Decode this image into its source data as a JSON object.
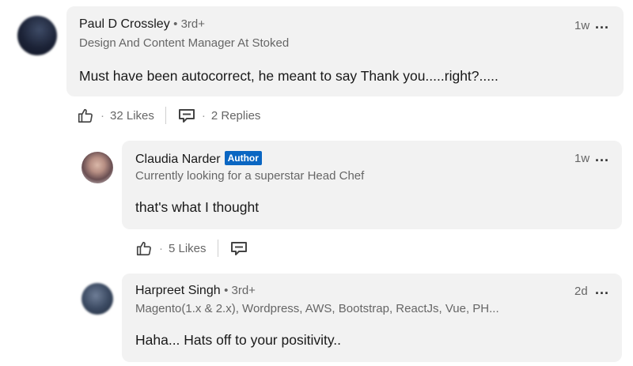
{
  "comments": [
    {
      "name": "Paul D Crossley",
      "degree": "• 3rd+",
      "headline": "Design And Content Manager At Stoked",
      "text": "Must have been autocorrect, he meant to say Thank you.....right?.....",
      "time": "1w",
      "more": "...",
      "likes": "32 Likes",
      "replies": "2 Replies",
      "like_icon": "like-icon",
      "reply_icon": "reply-icon"
    },
    {
      "name": "Claudia Narder",
      "badge": "Author",
      "headline": "Currently looking for a superstar Head Chef",
      "text": "that's what I thought",
      "time": "1w",
      "more": "...",
      "likes": "5 Likes",
      "like_icon": "like-icon",
      "reply_icon": "reply-icon"
    },
    {
      "name": "Harpreet Singh",
      "degree": "• 3rd+",
      "headline": "Magento(1.x & 2.x), Wordpress, AWS, Bootstrap, ReactJs, Vue, PH...",
      "text": "Haha... Hats off to your positivity..",
      "time": "2d",
      "more": "..."
    }
  ],
  "separator_dot": "·",
  "colors": {
    "bubble": "#f2f2f2",
    "author_badge": "#0a66c2",
    "secondary_text": "#666666"
  }
}
